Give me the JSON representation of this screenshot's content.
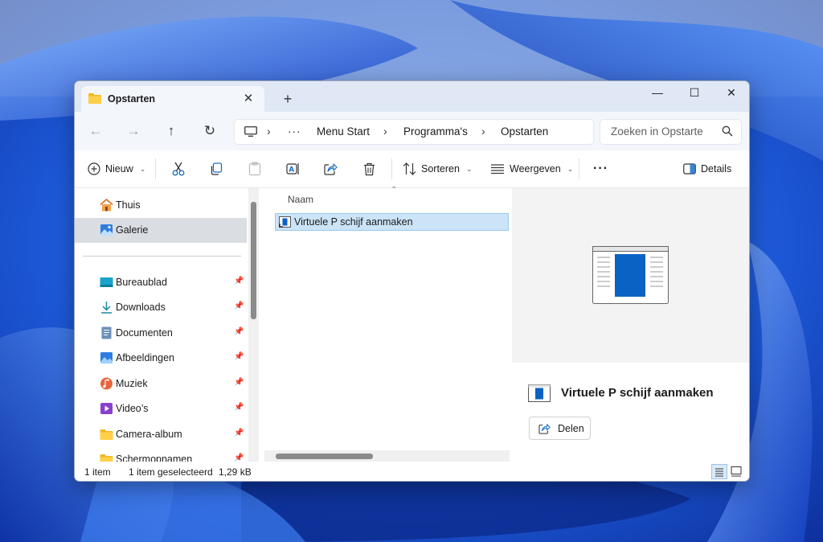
{
  "tab": {
    "title": "Opstarten",
    "close": "✕",
    "new": "+"
  },
  "window_controls": {
    "minimize": "—",
    "maximize": "☐",
    "close": "✕"
  },
  "nav": {
    "back": "←",
    "forward": "→",
    "up": "↑",
    "refresh": "↻"
  },
  "address": {
    "overflow": "···",
    "crumbs": [
      "Menu Start",
      "Programma's",
      "Opstarten"
    ],
    "separator": "›"
  },
  "search": {
    "placeholder": "Zoeken in Opstarte"
  },
  "toolbar": {
    "new_label": "Nieuw",
    "sort_label": "Sorteren",
    "view_label": "Weergeven",
    "more_label": "···",
    "details_label": "Details",
    "icons": [
      "cut-icon",
      "copy-icon",
      "paste-icon",
      "rename-icon",
      "share-icon",
      "delete-icon"
    ]
  },
  "sidebar": {
    "top_items": [
      {
        "label": "Thuis",
        "icon": "home-icon"
      },
      {
        "label": "Galerie",
        "icon": "gallery-icon",
        "selected": true
      }
    ],
    "pinned_items": [
      {
        "label": "Bureaublad",
        "icon": "desktop-icon"
      },
      {
        "label": "Downloads",
        "icon": "downloads-icon"
      },
      {
        "label": "Documenten",
        "icon": "documents-icon"
      },
      {
        "label": "Afbeeldingen",
        "icon": "pictures-icon"
      },
      {
        "label": "Muziek",
        "icon": "music-icon"
      },
      {
        "label": "Video’s",
        "icon": "videos-icon"
      },
      {
        "label": "Camera-album",
        "icon": "folder-icon"
      },
      {
        "label": "Schermopnamen",
        "icon": "folder-icon"
      }
    ]
  },
  "files": {
    "column_name": "Naam",
    "items": [
      {
        "name": "Virtuele P schijf aanmaken",
        "selected": true
      }
    ]
  },
  "details": {
    "file_name": "Virtuele P schijf aanmaken",
    "share_label": "Delen"
  },
  "status": {
    "count": "1 item",
    "selection": "1 item geselecteerd",
    "size": "1,29 kB"
  },
  "colors": {
    "accent": "#0067c0",
    "selection_bg": "#cce4f7",
    "wallpaper": "#1e5fd8"
  }
}
